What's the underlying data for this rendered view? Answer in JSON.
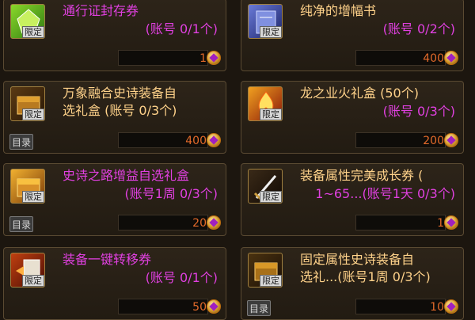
{
  "items": [
    {
      "name": "通行证封存券",
      "limit": "(账号 0/1个)",
      "price": "1",
      "tag": "限定",
      "icon": "green-gem-icon",
      "color": "#e040e0"
    },
    {
      "name": "纯净的增幅书",
      "limit": "(账号 0/2个)",
      "price": "400",
      "tag": "限定",
      "icon": "blue-book-icon",
      "color": "#ffd28a"
    },
    {
      "name": "万象融合史诗装备自",
      "name2": "选礼盒 (账号 0/3个)",
      "price": "400",
      "tag": "限定",
      "catalog": "目录",
      "icon": "gold-chest-icon",
      "color": "#ffd28a"
    },
    {
      "name": "龙之业火礼盒 (50个)",
      "limit": "(账号 0/3个)",
      "price": "200",
      "tag": "限定",
      "icon": "fire-box-icon",
      "color": "#e040e0"
    },
    {
      "name": "史诗之路增益自选礼盒",
      "limit": "(账号1周 0/3个)",
      "price": "20",
      "tag": "限定",
      "catalog": "目录",
      "icon": "gold-chest-icon",
      "color": "#e040e0"
    },
    {
      "name": "装备属性完美成长券 (",
      "limit": "1~65...(账号1天 0/3个)",
      "price": "1",
      "tag": "限定",
      "icon": "sword-ticket-icon",
      "color": "#e040e0"
    },
    {
      "name": "装备一键转移券",
      "limit": "(账号 0/1个)",
      "price": "50",
      "tag": "限定",
      "icon": "transfer-ticket-icon",
      "color": "#e040e0"
    },
    {
      "name": "固定属性史诗装备自",
      "name2": "选礼...(账号1周 0/3个)",
      "price": "10",
      "tag": "限定",
      "catalog": "目录",
      "icon": "gold-chest-icon",
      "color": "#ffd28a"
    }
  ]
}
